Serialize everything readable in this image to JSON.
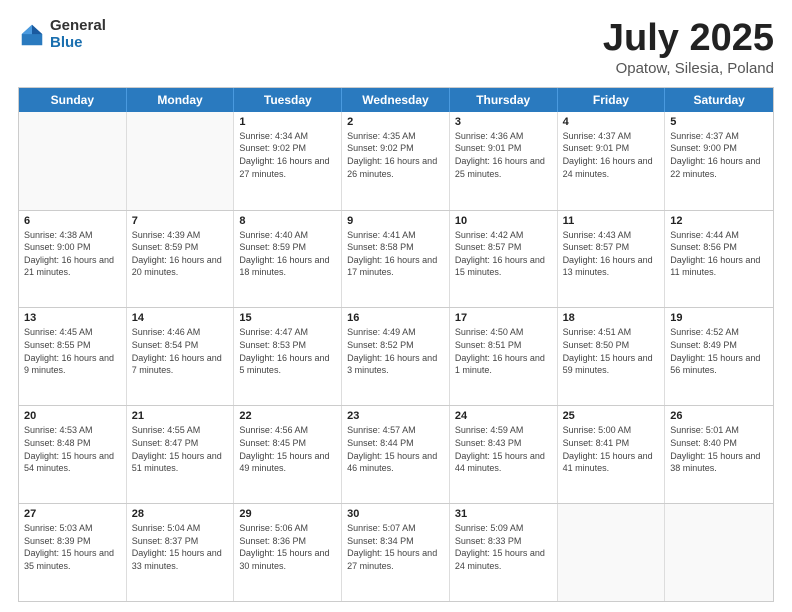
{
  "logo": {
    "general": "General",
    "blue": "Blue"
  },
  "title": {
    "month": "July 2025",
    "location": "Opatow, Silesia, Poland"
  },
  "weekdays": [
    "Sunday",
    "Monday",
    "Tuesday",
    "Wednesday",
    "Thursday",
    "Friday",
    "Saturday"
  ],
  "weeks": [
    [
      {
        "day": "",
        "info": ""
      },
      {
        "day": "",
        "info": ""
      },
      {
        "day": "1",
        "info": "Sunrise: 4:34 AM\nSunset: 9:02 PM\nDaylight: 16 hours and 27 minutes."
      },
      {
        "day": "2",
        "info": "Sunrise: 4:35 AM\nSunset: 9:02 PM\nDaylight: 16 hours and 26 minutes."
      },
      {
        "day": "3",
        "info": "Sunrise: 4:36 AM\nSunset: 9:01 PM\nDaylight: 16 hours and 25 minutes."
      },
      {
        "day": "4",
        "info": "Sunrise: 4:37 AM\nSunset: 9:01 PM\nDaylight: 16 hours and 24 minutes."
      },
      {
        "day": "5",
        "info": "Sunrise: 4:37 AM\nSunset: 9:00 PM\nDaylight: 16 hours and 22 minutes."
      }
    ],
    [
      {
        "day": "6",
        "info": "Sunrise: 4:38 AM\nSunset: 9:00 PM\nDaylight: 16 hours and 21 minutes."
      },
      {
        "day": "7",
        "info": "Sunrise: 4:39 AM\nSunset: 8:59 PM\nDaylight: 16 hours and 20 minutes."
      },
      {
        "day": "8",
        "info": "Sunrise: 4:40 AM\nSunset: 8:59 PM\nDaylight: 16 hours and 18 minutes."
      },
      {
        "day": "9",
        "info": "Sunrise: 4:41 AM\nSunset: 8:58 PM\nDaylight: 16 hours and 17 minutes."
      },
      {
        "day": "10",
        "info": "Sunrise: 4:42 AM\nSunset: 8:57 PM\nDaylight: 16 hours and 15 minutes."
      },
      {
        "day": "11",
        "info": "Sunrise: 4:43 AM\nSunset: 8:57 PM\nDaylight: 16 hours and 13 minutes."
      },
      {
        "day": "12",
        "info": "Sunrise: 4:44 AM\nSunset: 8:56 PM\nDaylight: 16 hours and 11 minutes."
      }
    ],
    [
      {
        "day": "13",
        "info": "Sunrise: 4:45 AM\nSunset: 8:55 PM\nDaylight: 16 hours and 9 minutes."
      },
      {
        "day": "14",
        "info": "Sunrise: 4:46 AM\nSunset: 8:54 PM\nDaylight: 16 hours and 7 minutes."
      },
      {
        "day": "15",
        "info": "Sunrise: 4:47 AM\nSunset: 8:53 PM\nDaylight: 16 hours and 5 minutes."
      },
      {
        "day": "16",
        "info": "Sunrise: 4:49 AM\nSunset: 8:52 PM\nDaylight: 16 hours and 3 minutes."
      },
      {
        "day": "17",
        "info": "Sunrise: 4:50 AM\nSunset: 8:51 PM\nDaylight: 16 hours and 1 minute."
      },
      {
        "day": "18",
        "info": "Sunrise: 4:51 AM\nSunset: 8:50 PM\nDaylight: 15 hours and 59 minutes."
      },
      {
        "day": "19",
        "info": "Sunrise: 4:52 AM\nSunset: 8:49 PM\nDaylight: 15 hours and 56 minutes."
      }
    ],
    [
      {
        "day": "20",
        "info": "Sunrise: 4:53 AM\nSunset: 8:48 PM\nDaylight: 15 hours and 54 minutes."
      },
      {
        "day": "21",
        "info": "Sunrise: 4:55 AM\nSunset: 8:47 PM\nDaylight: 15 hours and 51 minutes."
      },
      {
        "day": "22",
        "info": "Sunrise: 4:56 AM\nSunset: 8:45 PM\nDaylight: 15 hours and 49 minutes."
      },
      {
        "day": "23",
        "info": "Sunrise: 4:57 AM\nSunset: 8:44 PM\nDaylight: 15 hours and 46 minutes."
      },
      {
        "day": "24",
        "info": "Sunrise: 4:59 AM\nSunset: 8:43 PM\nDaylight: 15 hours and 44 minutes."
      },
      {
        "day": "25",
        "info": "Sunrise: 5:00 AM\nSunset: 8:41 PM\nDaylight: 15 hours and 41 minutes."
      },
      {
        "day": "26",
        "info": "Sunrise: 5:01 AM\nSunset: 8:40 PM\nDaylight: 15 hours and 38 minutes."
      }
    ],
    [
      {
        "day": "27",
        "info": "Sunrise: 5:03 AM\nSunset: 8:39 PM\nDaylight: 15 hours and 35 minutes."
      },
      {
        "day": "28",
        "info": "Sunrise: 5:04 AM\nSunset: 8:37 PM\nDaylight: 15 hours and 33 minutes."
      },
      {
        "day": "29",
        "info": "Sunrise: 5:06 AM\nSunset: 8:36 PM\nDaylight: 15 hours and 30 minutes."
      },
      {
        "day": "30",
        "info": "Sunrise: 5:07 AM\nSunset: 8:34 PM\nDaylight: 15 hours and 27 minutes."
      },
      {
        "day": "31",
        "info": "Sunrise: 5:09 AM\nSunset: 8:33 PM\nDaylight: 15 hours and 24 minutes."
      },
      {
        "day": "",
        "info": ""
      },
      {
        "day": "",
        "info": ""
      }
    ]
  ]
}
